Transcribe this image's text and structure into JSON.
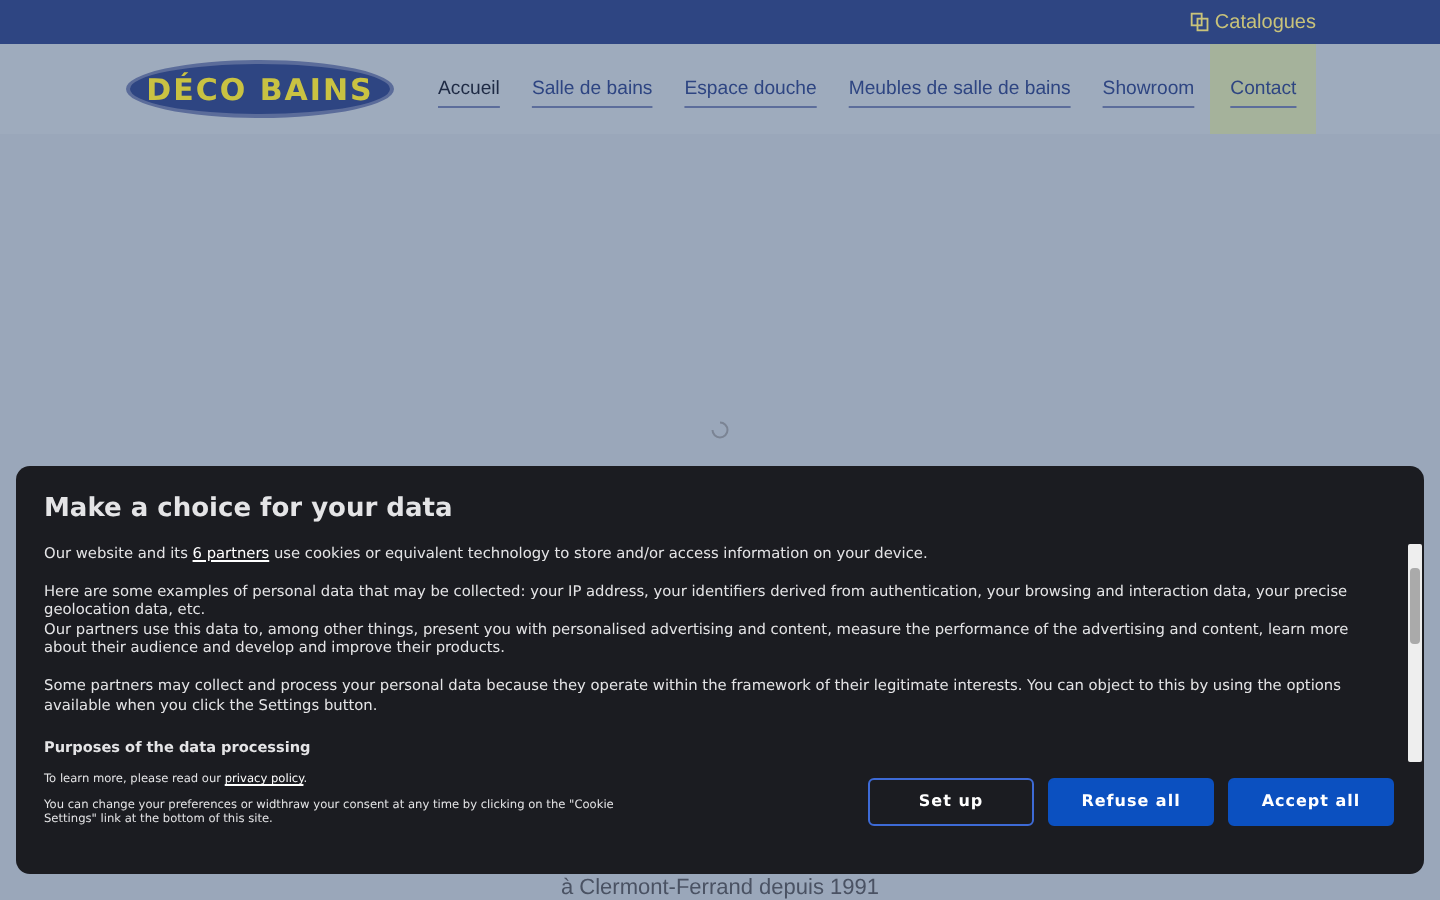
{
  "top_bar": {
    "catalog_link": "Catalogues"
  },
  "header": {
    "logo": "DÉCO BAINS",
    "nav": [
      {
        "label": "Accueil",
        "selected": true,
        "highlighted": false
      },
      {
        "label": "Salle de bains",
        "selected": false,
        "highlighted": false
      },
      {
        "label": "Espace douche",
        "selected": false,
        "highlighted": false
      },
      {
        "label": "Meubles de salle de bains",
        "selected": false,
        "highlighted": false
      },
      {
        "label": "Showroom",
        "selected": false,
        "highlighted": false
      },
      {
        "label": "Contact",
        "selected": false,
        "highlighted": true
      }
    ]
  },
  "hero": {
    "loading": true,
    "subtitle": "à Clermont-Ferrand depuis 1991"
  },
  "consent_dialog": {
    "title": "Make a choice for your data",
    "intro": {
      "before": "Our website and its ",
      "link": "6 partners",
      "after": " use cookies or equivalent technology to store and/or access information on your device."
    },
    "paragraphs": [
      "Here are some examples of personal data that may be collected: your IP address, your identifiers derived from authentication, your browsing and interaction data, your precise geolocation data, etc.",
      "Our partners use this data to, among other things, present you with personalised advertising and content, measure the performance of the advertising and content, learn more about their audience and develop and improve their products.",
      "Some partners may collect and process your personal data because they operate within the framework of their legitimate interests. You can object to this by using the options available when you click the Settings button."
    ],
    "section_heading": "Purposes of the data processing",
    "learn_more": {
      "before": "To learn more, please read our ",
      "link": "privacy policy",
      "after": "."
    },
    "note": "You can change your preferences or widthraw your consent at any time by clicking on the \"Cookie Settings\" link at the bottom of this site.",
    "buttons": [
      {
        "label": "Set up",
        "kind": "outline"
      },
      {
        "label": "Refuse all",
        "kind": "filled"
      },
      {
        "label": "Accept all",
        "kind": "filled"
      }
    ]
  }
}
